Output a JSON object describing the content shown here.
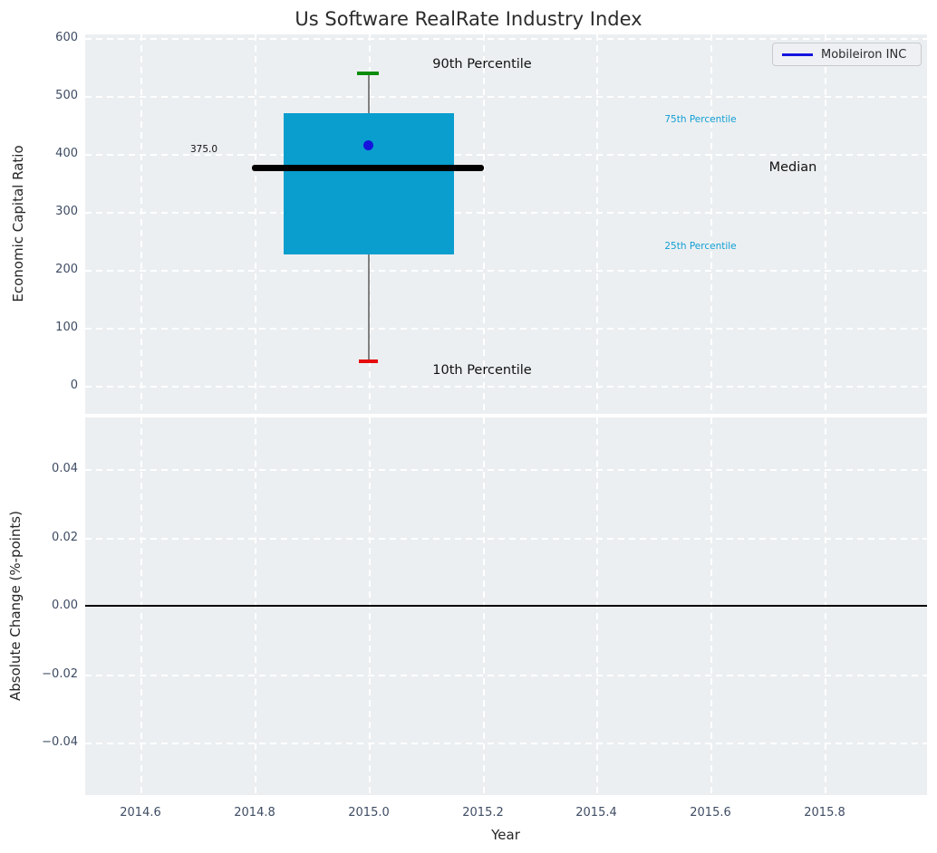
{
  "title": "Us Software RealRate Industry Index",
  "legend": {
    "label": "Mobileiron INC"
  },
  "top_axes": {
    "ylabel": "Economic Capital Ratio",
    "yticks": [
      "600",
      "500",
      "400",
      "300",
      "200",
      "100",
      "0"
    ],
    "annotations": {
      "p90": "90th Percentile",
      "p75": "75th Percentile",
      "median": "Median",
      "p25": "25th Percentile",
      "p10": "10th Percentile",
      "median_value": "375.0"
    }
  },
  "bottom_axes": {
    "ylabel": "Absolute Change (%-points)",
    "xlabel": "Year",
    "yticks": [
      "0.04",
      "0.02",
      "0.00",
      "−0.02",
      "−0.04"
    ],
    "xticks": [
      "2014.6",
      "2014.8",
      "2015.0",
      "2015.2",
      "2015.4",
      "2015.6",
      "2015.8"
    ]
  },
  "colors": {
    "box_fill": "#099ece",
    "percentile_text_cyan": "#119fd4",
    "cap_90th": "#0a8c0a",
    "cap_10th": "#e60c0c",
    "company_blue": "#1414dd",
    "median_line": "#000000",
    "axes_background": "#eceff1",
    "tick_label": "#3e4c63"
  },
  "chart_data": [
    {
      "type": "box",
      "title": "Us Software RealRate Industry Index",
      "ylabel": "Economic Capital Ratio",
      "x": 2015.0,
      "box": {
        "p10": 42,
        "p25": 227,
        "median": 375,
        "p75": 470,
        "p90": 537,
        "box_x_range": [
          2014.85,
          2015.15
        ],
        "median_x_range": [
          2014.79,
          2015.21
        ]
      },
      "median_data_label": 375.0,
      "points": [
        {
          "name": "Mobileiron INC",
          "x": 2015.0,
          "y": 413,
          "color": "#1414dd"
        }
      ],
      "annotations": [
        "90th Percentile",
        "75th Percentile",
        "Median",
        "25th Percentile",
        "10th Percentile"
      ],
      "yticks": [
        0,
        100,
        200,
        300,
        400,
        500,
        600
      ],
      "ylim": [
        -48,
        606
      ],
      "xlim": [
        2014.5,
        2015.98
      ],
      "grid": true,
      "legend": {
        "entries": [
          "Mobileiron INC"
        ],
        "position": "upper right"
      }
    },
    {
      "type": "line",
      "ylabel": "Absolute Change (%-points)",
      "xlabel": "Year",
      "series": [],
      "hline": 0.0,
      "yticks": [
        0.04,
        0.02,
        0.0,
        -0.02,
        -0.04
      ],
      "xticks": [
        2014.6,
        2014.8,
        2015.0,
        2015.2,
        2015.4,
        2015.6,
        2015.8
      ],
      "ylim": [
        -0.055,
        0.055
      ],
      "xlim": [
        2014.5,
        2015.98
      ],
      "grid": true
    }
  ]
}
